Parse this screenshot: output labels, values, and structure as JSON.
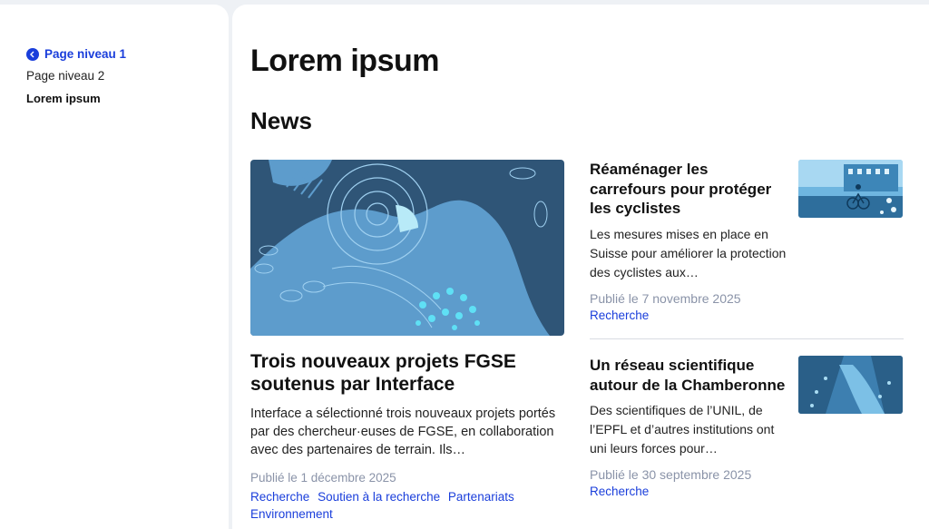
{
  "sidebar": {
    "breadcrumbs": [
      {
        "label": "Page niveau 1",
        "icon": "chevron-left-icon"
      },
      {
        "label": "Page niveau 2"
      },
      {
        "label": "Lorem ipsum"
      }
    ]
  },
  "main": {
    "page_title": "Lorem ipsum",
    "section_title": "News",
    "featured": {
      "title": "Trois nouveaux projets FGSE soutenus par Interface",
      "description": "Interface a sélectionné trois nouveaux projets portés par des chercheur·euses de FGSE, en collaboration avec des partenaires de terrain. Ils…",
      "date": "Publié le 1 décembre 2025",
      "tags": [
        "Recherche",
        "Soutien à la recherche",
        "Partenariats",
        "Environnement"
      ]
    },
    "news": [
      {
        "title": "Réaménager les carrefours pour protéger les cyclistes",
        "description": "Les mesures mises en place en Suisse pour améliorer la protection des cyclistes aux…",
        "date": "Publié le 7 novembre 2025",
        "category": "Recherche"
      },
      {
        "title": "Un réseau scientifique autour de la Chamberonne",
        "description": "Des scientifiques de l’UNIL, de l’EPFL et d’autres institutions ont uni leurs forces pour…",
        "date": "Publié le 30 septembre 2025",
        "category": "Recherche"
      }
    ]
  },
  "colors": {
    "accent": "#1a3edb",
    "muted_text": "#8a93a8",
    "illustration_dark": "#2f5577",
    "illustration_light": "#5d9ccc"
  }
}
